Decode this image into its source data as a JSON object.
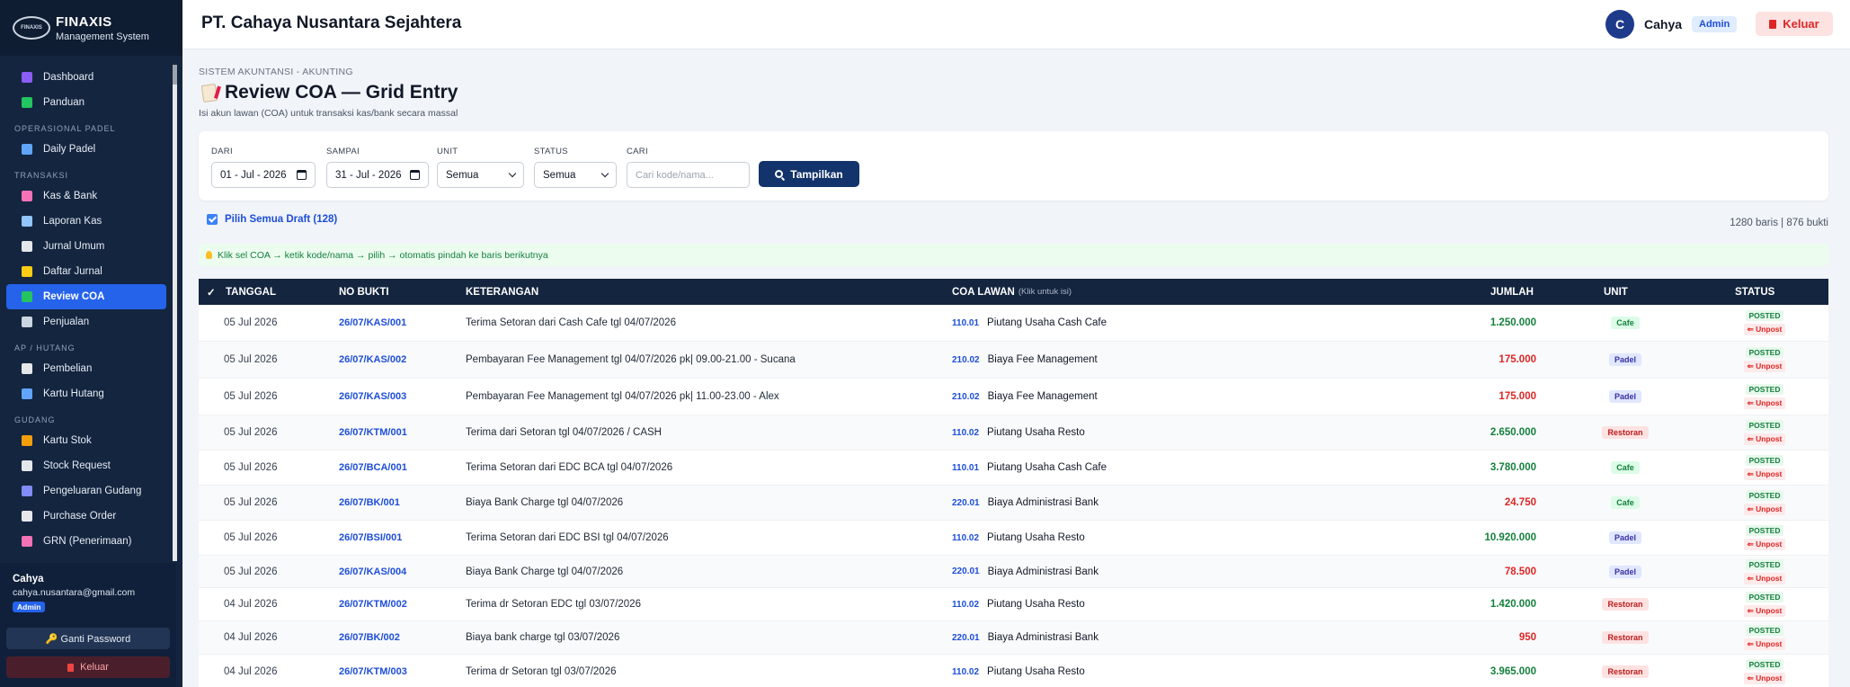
{
  "brand": {
    "logo_text": "FINAXIS",
    "name": "FINAXIS",
    "subtitle": "Management System"
  },
  "sidebar": {
    "items": [
      {
        "type": "item",
        "label": "Dashboard",
        "icon": "dashboard-icon",
        "color": "#8b5cf6"
      },
      {
        "type": "item",
        "label": "Panduan",
        "icon": "book-icon",
        "color": "#22c55e"
      },
      {
        "type": "section",
        "label": "OPERASIONAL PADEL"
      },
      {
        "type": "item",
        "label": "Daily Padel",
        "icon": "padel-icon",
        "color": "#60a5fa"
      },
      {
        "type": "section",
        "label": "TRANSAKSI"
      },
      {
        "type": "item",
        "label": "Kas & Bank",
        "icon": "bank-icon",
        "color": "#f472b6"
      },
      {
        "type": "item",
        "label": "Laporan Kas",
        "icon": "chart-icon",
        "color": "#93c5fd"
      },
      {
        "type": "item",
        "label": "Jurnal Umum",
        "icon": "journal-icon",
        "color": "#e5e7eb"
      },
      {
        "type": "item",
        "label": "Daftar Jurnal",
        "icon": "notes-icon",
        "color": "#facc15"
      },
      {
        "type": "item",
        "label": "Review COA",
        "icon": "check-icon",
        "color": "#22c55e",
        "active": true
      },
      {
        "type": "item",
        "label": "Penjualan",
        "icon": "register-icon",
        "color": "#cbd5e1"
      },
      {
        "type": "section",
        "label": "AP / HUTANG"
      },
      {
        "type": "item",
        "label": "Pembelian",
        "icon": "receipt-icon",
        "color": "#e5e7eb"
      },
      {
        "type": "item",
        "label": "Kartu Hutang",
        "icon": "card-icon",
        "color": "#60a5fa"
      },
      {
        "type": "section",
        "label": "GUDANG"
      },
      {
        "type": "item",
        "label": "Kartu Stok",
        "icon": "box-icon",
        "color": "#f59e0b"
      },
      {
        "type": "item",
        "label": "Stock Request",
        "icon": "request-icon",
        "color": "#e5e7eb"
      },
      {
        "type": "item",
        "label": "Pengeluaran Gudang",
        "icon": "outbox-icon",
        "color": "#818cf8"
      },
      {
        "type": "item",
        "label": "Purchase Order",
        "icon": "order-icon",
        "color": "#e5e7eb"
      },
      {
        "type": "item",
        "label": "GRN (Penerimaan)",
        "icon": "truck-icon",
        "color": "#f472b6"
      }
    ]
  },
  "user": {
    "name": "Cahya",
    "email": "cahya.nusantara@gmail.com",
    "role": "Admin",
    "change_password": "🔑 Ganti Password",
    "logout": "Keluar"
  },
  "header": {
    "company": "PT. Cahaya Nusantara Sejahtera",
    "avatar_letter": "C",
    "user": "Cahya",
    "role": "Admin",
    "logout": "Keluar"
  },
  "page": {
    "breadcrumb": "SISTEM AKUNTANSI - AKUNTING",
    "title": "Review COA — Grid Entry",
    "subtitle": "Isi akun lawan (COA) untuk transaksi kas/bank secara massal"
  },
  "filters": {
    "from_label": "DARI",
    "from_value": "01 - Jul - 2026",
    "to_label": "SAMPAI",
    "to_value": "31 - Jul - 2026",
    "unit_label": "UNIT",
    "unit_value": "Semua",
    "status_label": "STATUS",
    "status_value": "Semua",
    "search_label": "CARI",
    "search_placeholder": "Cari kode/nama...",
    "show_button": "Tampilkan"
  },
  "select_all": "Pilih Semua Draft (128)",
  "counts": "1280 baris | 876 bukti",
  "hint": "Klik sel COA → ketik kode/nama → pilih → otomatis pindah ke baris berikutnya",
  "table": {
    "headers": {
      "check": "✓",
      "tanggal": "TANGGAL",
      "no_bukti": "NO BUKTI",
      "keterangan": "KETERANGAN",
      "coa": "COA LAWAN",
      "coa_hint": "(Klik untuk isi)",
      "jumlah": "JUMLAH",
      "unit": "UNIT",
      "status": "STATUS"
    },
    "rows": [
      {
        "tanggal": "05 Jul 2026",
        "no_bukti": "26/07/KAS/001",
        "keterangan": "Terima Setoran dari Cash Cafe tgl 04/07/2026",
        "coa_code": "110.01",
        "coa_name": "Piutang Usaha Cash Cafe",
        "jumlah": "1.250.000",
        "amount_color": "#15803d",
        "unit": "Cafe",
        "status": "POSTED",
        "action": "⇐ Unpost"
      },
      {
        "tanggal": "05 Jul 2026",
        "no_bukti": "26/07/KAS/002",
        "keterangan": "Pembayaran Fee Management tgl 04/07/2026 pk| 09.00-21.00 - Sucana",
        "coa_code": "210.02",
        "coa_name": "Biaya Fee Management",
        "jumlah": "175.000",
        "amount_color": "#dc2626",
        "unit": "Padel",
        "status": "POSTED",
        "action": "⇐ Unpost"
      },
      {
        "tanggal": "05 Jul 2026",
        "no_bukti": "26/07/KAS/003",
        "keterangan": "Pembayaran Fee Management tgl 04/07/2026 pk| 11.00-23.00 - Alex",
        "coa_code": "210.02",
        "coa_name": "Biaya Fee Management",
        "jumlah": "175.000",
        "amount_color": "#dc2626",
        "unit": "Padel",
        "status": "POSTED",
        "action": "⇐ Unpost"
      },
      {
        "tanggal": "05 Jul 2026",
        "no_bukti": "26/07/KTM/001",
        "keterangan": "Terima dari Setoran tgl 04/07/2026 / CASH",
        "coa_code": "110.02",
        "coa_name": "Piutang Usaha Resto",
        "jumlah": "2.650.000",
        "amount_color": "#15803d",
        "unit": "Restoran",
        "status": "POSTED",
        "action": "⇐ Unpost"
      },
      {
        "tanggal": "05 Jul 2026",
        "no_bukti": "26/07/BCA/001",
        "keterangan": "Terima Setoran dari EDC BCA tgl 04/07/2026",
        "coa_code": "110.01",
        "coa_name": "Piutang Usaha Cash Cafe",
        "jumlah": "3.780.000",
        "amount_color": "#15803d",
        "unit": "Cafe",
        "status": "POSTED",
        "action": "⇐ Unpost"
      },
      {
        "tanggal": "05 Jul 2026",
        "no_bukti": "26/07/BK/001",
        "keterangan": "Biaya Bank Charge tgl 04/07/2026",
        "coa_code": "220.01",
        "coa_name": "Biaya Administrasi Bank",
        "jumlah": "24.750",
        "amount_color": "#dc2626",
        "unit": "Cafe",
        "status": "POSTED",
        "action": "⇐ Unpost"
      },
      {
        "tanggal": "05 Jul 2026",
        "no_bukti": "26/07/BSI/001",
        "keterangan": "Terima Setoran dari EDC BSI tgl 04/07/2026",
        "coa_code": "110.02",
        "coa_name": "Piutang Usaha Resto",
        "jumlah": "10.920.000",
        "amount_color": "#15803d",
        "unit": "Padel",
        "status": "POSTED",
        "action": "⇐ Unpost"
      },
      {
        "tanggal": "05 Jul 2026",
        "no_bukti": "26/07/KAS/004",
        "keterangan": "Biaya Bank Charge tgl 04/07/2026",
        "coa_code": "220.01",
        "coa_name": "Biaya Administrasi Bank",
        "jumlah": "78.500",
        "amount_color": "#dc2626",
        "unit": "Padel",
        "status": "POSTED",
        "action": "⇐ Unpost"
      },
      {
        "tanggal": "04 Jul 2026",
        "no_bukti": "26/07/KTM/002",
        "keterangan": "Terima dr Setoran EDC tgl 03/07/2026",
        "coa_code": "110.02",
        "coa_name": "Piutang Usaha Resto",
        "jumlah": "1.420.000",
        "amount_color": "#15803d",
        "unit": "Restoran",
        "status": "POSTED",
        "action": "⇐ Unpost"
      },
      {
        "tanggal": "04 Jul 2026",
        "no_bukti": "26/07/BK/002",
        "keterangan": "Biaya bank charge tgl 03/07/2026",
        "coa_code": "220.01",
        "coa_name": "Biaya Administrasi Bank",
        "jumlah": "950",
        "amount_color": "#dc2626",
        "unit": "Restoran",
        "status": "POSTED",
        "action": "⇐ Unpost"
      },
      {
        "tanggal": "04 Jul 2026",
        "no_bukti": "26/07/KTM/003",
        "keterangan": "Terima dr Setoran tgl 03/07/2026",
        "coa_code": "110.02",
        "coa_name": "Piutang Usaha Resto",
        "jumlah": "3.965.000",
        "amount_color": "#15803d",
        "unit": "Restoran",
        "status": "POSTED",
        "action": "⇐ Unpost"
      }
    ]
  },
  "unit_colors": {
    "Cafe": {
      "bg": "#dcfce7",
      "fg": "#15803d"
    },
    "Padel": {
      "bg": "#e0e7ff",
      "fg": "#3730a3"
    },
    "Restoran": {
      "bg": "#fee2e2",
      "fg": "#b91c1c"
    }
  }
}
